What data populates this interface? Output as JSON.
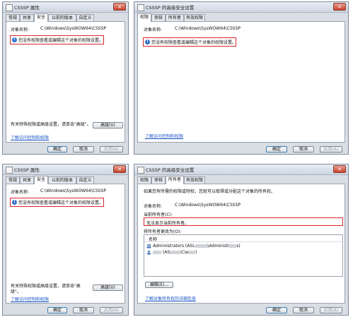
{
  "win1": {
    "title": "CSSSP 属性",
    "tabs": [
      "常规",
      "共享",
      "安全",
      "以前的版本",
      "自定义"
    ],
    "active_tab": "安全",
    "object_label": "对象名称:",
    "object_value": "C:\\Windows\\SysWOW64\\CSSSP",
    "message": "您没有权限查看或编辑这个对象的权限设置。",
    "special_perm_text": "有关特殊权限或高级设置，请单击\"高级\"。",
    "special_perm_text_l2": "级\"。",
    "advanced_button": "高级(V)",
    "link": "了解访问控制和权限",
    "ok": "确定",
    "cancel": "取消",
    "apply": "应用(A)"
  },
  "win2": {
    "title": "CSSSP 的高级安全设置",
    "tabs": [
      "权限",
      "审核",
      "所有者",
      "有效权限"
    ],
    "active_tab": "权限",
    "object_label": "对象名称:",
    "object_value": "C:\\Windows\\SysWOW64\\CSSSP",
    "message": "您没有权限查看或编辑这个对象的权限设置。",
    "link": "了解访问控制和权限",
    "ok": "确定",
    "cancel": "取消",
    "apply": "应用(A)"
  },
  "win3": {
    "title": "CSSSP 属性",
    "tabs": [
      "常规",
      "共享",
      "安全",
      "以前的版本",
      "自定义"
    ],
    "active_tab": "安全",
    "object_label": "对象名称:",
    "object_value": "C:\\Windows\\SysWOW64\\CSSSP",
    "message": "您没有权限查看或编辑这个对象的权限设置。",
    "special_perm_text": "有关特殊权限或高级设置，请单击\"高",
    "special_perm_text_l2": "级\"。",
    "advanced_button": "高级(V)",
    "link": "了解访问控制和权限",
    "ok": "确定",
    "cancel": "取消",
    "apply": "应用(A)"
  },
  "win4": {
    "title": "CSSSP 的高级安全设置",
    "tabs": [
      "权限",
      "审核",
      "所有者",
      "有效权限"
    ],
    "active_tab": "所有者",
    "intro": "如果您有所需的权限或特权，您就可以取得或分配这个对象的所有权。",
    "object_label": "对象名称:",
    "object_value": "C:\\Windows\\SysWOW64\\CSSSP",
    "current_owner_label": "当前所有者(C):",
    "current_owner_value": "无法显示当前所有者。",
    "change_owner_label": "将所有者更改为(O):",
    "list_header": "名称",
    "list_items": [
      {
        "name": "Administrators (ASL",
        "suffix": "\\Administr",
        "tail": "s)"
      },
      {
        "name": "",
        "suffix": "(AS",
        "tail": "\\C\\e",
        "end": ")"
      }
    ],
    "edit_button": "编辑(E)...",
    "link": "了解对象所有权的详细信息",
    "ok": "确定",
    "cancel": "取消",
    "apply": "应用(A)"
  },
  "colors": {
    "highlight_border": "#d9262b",
    "link": "#1a55c7",
    "info_icon": "#2f6fcf"
  }
}
